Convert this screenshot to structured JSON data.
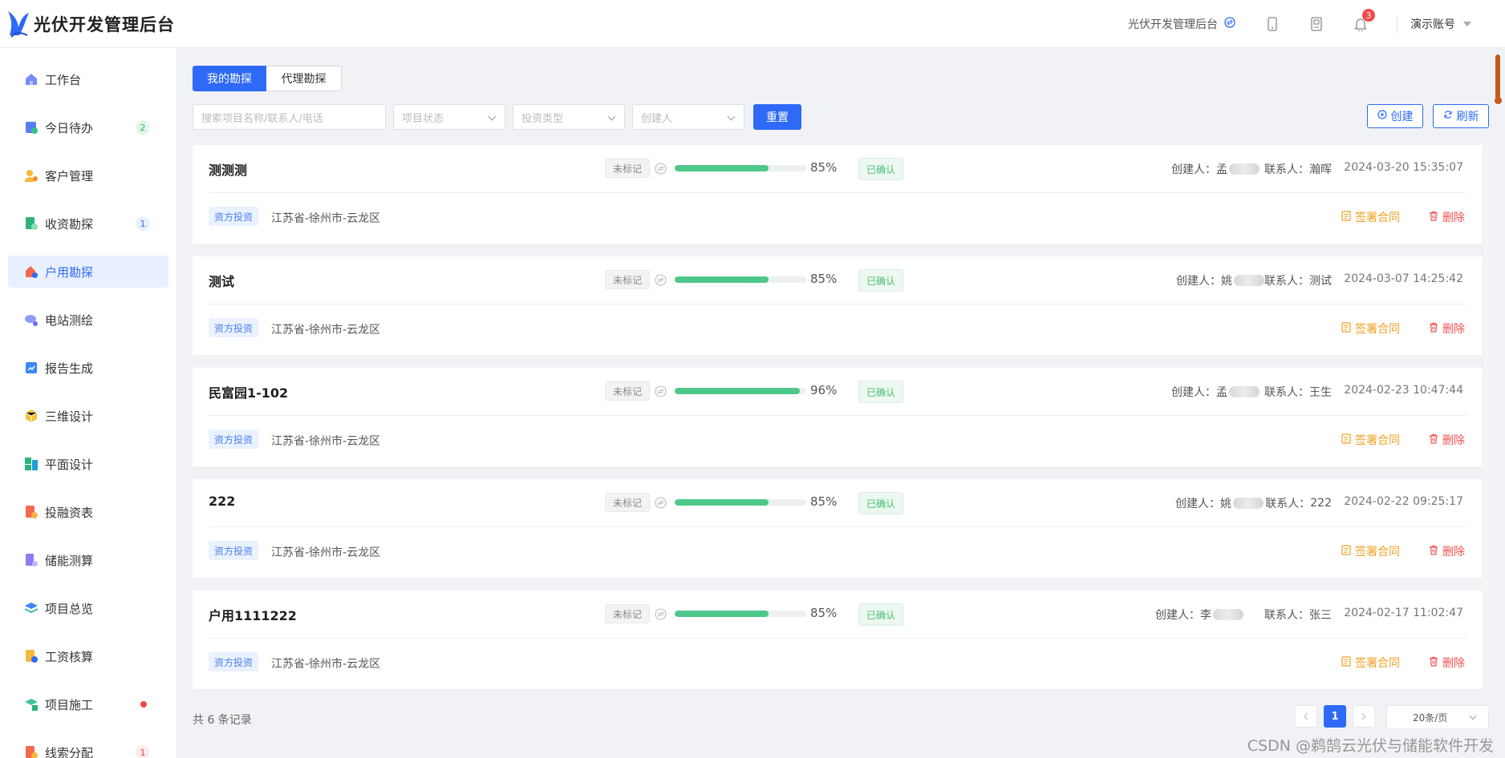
{
  "app": {
    "title": "光伏开发管理后台"
  },
  "header": {
    "link_label": "光伏开发管理后台",
    "notification_count": "3",
    "account_label": "演示账号"
  },
  "sidebar": {
    "items": [
      {
        "label": "工作台",
        "icon": "home-icon"
      },
      {
        "label": "今日待办",
        "icon": "todo-icon",
        "badge": "2"
      },
      {
        "label": "客户管理",
        "icon": "customer-icon"
      },
      {
        "label": "收资勘探",
        "icon": "document-check-icon",
        "badge": "1"
      },
      {
        "label": "户用勘探",
        "icon": "house-survey-icon"
      },
      {
        "label": "电站测绘",
        "icon": "survey-icon"
      },
      {
        "label": "报告生成",
        "icon": "report-icon"
      },
      {
        "label": "三维设计",
        "icon": "cube-icon"
      },
      {
        "label": "平面设计",
        "icon": "layout-icon"
      },
      {
        "label": "投融资表",
        "icon": "finance-icon"
      },
      {
        "label": "储能测算",
        "icon": "storage-icon"
      },
      {
        "label": "项目总览",
        "icon": "layers-icon"
      },
      {
        "label": "工资核算",
        "icon": "salary-icon"
      },
      {
        "label": "项目施工",
        "icon": "construction-icon"
      },
      {
        "label": "线索分配",
        "icon": "lead-icon",
        "badge": "1"
      }
    ]
  },
  "tabs": [
    {
      "label": "我的勘探"
    },
    {
      "label": "代理勘探"
    }
  ],
  "filters": {
    "search_placeholder": "搜索项目名称/联系人/电话",
    "status_placeholder": "项目状态",
    "investment_placeholder": "投资类型",
    "creator_placeholder": "创建人",
    "reset_label": "重置",
    "create_label": "创建",
    "refresh_label": "刷新"
  },
  "labels": {
    "creator": "创建人：",
    "contact": "联系人：",
    "sign": "签署合同",
    "delete": "删除"
  },
  "cards": [
    {
      "title": "测测测",
      "mark_status": "未标记",
      "progress": 85,
      "progress_text": "85%",
      "confirm_status": "已确认",
      "creator_initial": "孟",
      "contact": "瀚晖",
      "date": "2024-03-20 15:35:07",
      "investment_tag": "资方投资",
      "address": "江苏省-徐州市-云龙区"
    },
    {
      "title": "测试",
      "mark_status": "未标记",
      "progress": 85,
      "progress_text": "85%",
      "confirm_status": "已确认",
      "creator_initial": "姚",
      "contact": "测试",
      "date": "2024-03-07 14:25:42",
      "investment_tag": "资方投资",
      "address": "江苏省-徐州市-云龙区"
    },
    {
      "title": "民富园1-102",
      "mark_status": "未标记",
      "progress": 96,
      "progress_text": "96%",
      "confirm_status": "已确认",
      "creator_initial": "孟",
      "contact": "王生",
      "date": "2024-02-23 10:47:44",
      "investment_tag": "资方投资",
      "address": "江苏省-徐州市-云龙区"
    },
    {
      "title": "222",
      "mark_status": "未标记",
      "progress": 85,
      "progress_text": "85%",
      "confirm_status": "已确认",
      "creator_initial": "姚",
      "contact": "222",
      "date": "2024-02-22 09:25:17",
      "investment_tag": "资方投资",
      "address": "江苏省-徐州市-云龙区"
    },
    {
      "title": "户用1111222",
      "mark_status": "未标记",
      "progress": 85,
      "progress_text": "85%",
      "confirm_status": "已确认",
      "creator_initial": "李",
      "contact": "张三",
      "date": "2024-02-17 11:02:47",
      "investment_tag": "资方投资",
      "address": "江苏省-徐州市-云龙区"
    }
  ],
  "pagination": {
    "total_label": "共 6 条记录",
    "current_page": "1",
    "page_size_label": "20条/页"
  },
  "watermark": "CSDN @鹈鹄云光伏与储能软件开发",
  "colors": {
    "primary": "#2e6af6",
    "success": "#4ec88a",
    "warning": "#f0a020",
    "danger": "#f05050"
  }
}
